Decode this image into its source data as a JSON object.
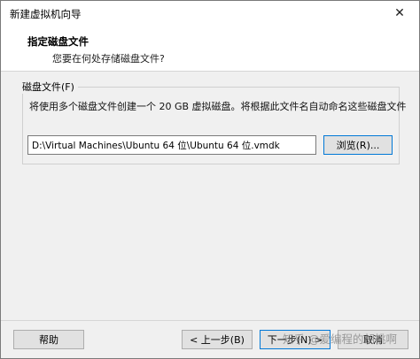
{
  "window": {
    "title": "新建虚拟机向导",
    "close_glyph": "✕"
  },
  "header": {
    "title": "指定磁盘文件",
    "subtitle": "您要在何处存储磁盘文件?"
  },
  "disk_file": {
    "group_label": "磁盘文件(F)",
    "description": "将使用多个磁盘文件创建一个 20 GB 虚拟磁盘。将根据此文件名自动命名这些磁盘文件",
    "path_value": "D:\\Virtual Machines\\Ubuntu 64 位\\Ubuntu 64 位.vmdk",
    "browse_label": "浏览(R)..."
  },
  "footer": {
    "help_label": "帮助",
    "back_label": "< 上一步(B)",
    "next_label": "下一步(N) >",
    "cancel_label": "取消"
  },
  "watermark": "知乎 @爱编程的胡桃啊",
  "colors": {
    "accent": "#0078d7",
    "dialog_bg": "#f0f0f0",
    "header_bg": "#ffffff"
  }
}
